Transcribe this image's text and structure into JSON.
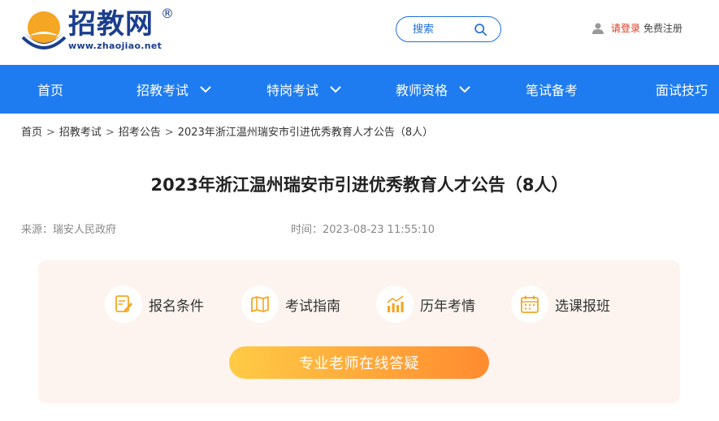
{
  "brand": {
    "name": "招教网",
    "registered": "®",
    "url": "www.zhaojiao.net",
    "primary_color": "#1f7cf0",
    "logo_color": "#1b3f8f",
    "accent_color": "#f5a623"
  },
  "header": {
    "search_label": "搜索",
    "login_label": "请登录",
    "register_label": "免费注册"
  },
  "nav": {
    "items": [
      {
        "label": "首页",
        "has_dropdown": false
      },
      {
        "label": "招教考试",
        "has_dropdown": true
      },
      {
        "label": "特岗考试",
        "has_dropdown": true
      },
      {
        "label": "教师资格",
        "has_dropdown": true
      },
      {
        "label": "笔试备考",
        "has_dropdown": false
      },
      {
        "label": "面试技巧",
        "has_dropdown": false
      }
    ]
  },
  "breadcrumb": {
    "items": [
      "首页",
      "招教考试",
      "招考公告",
      "2023年浙江温州瑞安市引进优秀教育人才公告（8人）"
    ],
    "separator": ">"
  },
  "article": {
    "title": "2023年浙江温州瑞安市引进优秀教育人才公告（8人）",
    "source": "来源：瑞安人民政府",
    "time": "时间：2023-08-23 11:55:10"
  },
  "panel": {
    "features": [
      {
        "label": "报名条件",
        "icon": "edit-form-icon"
      },
      {
        "label": "考试指南",
        "icon": "map-guide-icon"
      },
      {
        "label": "历年考情",
        "icon": "bar-chart-icon"
      },
      {
        "label": "选课报班",
        "icon": "calendar-icon"
      }
    ],
    "cta_label": "专业老师在线答疑"
  }
}
